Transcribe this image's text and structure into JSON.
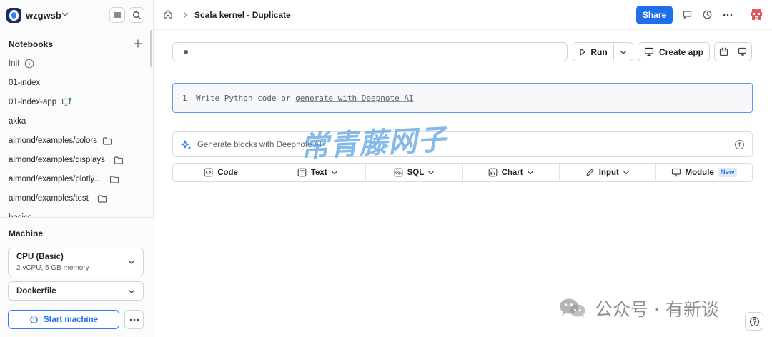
{
  "workspace": {
    "name": "wzgwsb"
  },
  "sidebar": {
    "notebooks_title": "Notebooks",
    "items": [
      {
        "label": "Init",
        "suffix_icon": "lightning-icon"
      },
      {
        "label": "01-index",
        "suffix_icon": ""
      },
      {
        "label": "01-index-app",
        "suffix_icon": "app-monitor-icon"
      },
      {
        "label": "akka",
        "suffix_icon": ""
      },
      {
        "label": "almond/examples/colors",
        "suffix_icon": "folder-icon"
      },
      {
        "label": "almond/examples/displays",
        "suffix_icon": "folder-icon"
      },
      {
        "label": "almond/examples/plotly...",
        "suffix_icon": "folder-icon"
      },
      {
        "label": "almond/examples/test",
        "suffix_icon": "folder-icon"
      },
      {
        "label": "basics",
        "suffix_icon": ""
      }
    ],
    "machine": {
      "title": "Machine",
      "cpu_name": "CPU (Basic)",
      "cpu_spec": "2 vCPU, 5 GB memory",
      "environment": "Dockerfile",
      "start_label": "Start machine"
    }
  },
  "topbar": {
    "breadcrumb_title": "Scala kernel - Duplicate",
    "share_label": "Share"
  },
  "notebook": {
    "run_label": "Run",
    "create_app_label": "Create app",
    "code_cell": {
      "line_number": "1",
      "placeholder_prefix": "Write Python code or ",
      "placeholder_link": "generate with Deepnote AI"
    },
    "generate_placeholder": "Generate blocks with Deepnote AI",
    "block_types": [
      {
        "label": "Code",
        "icon": "code-icon",
        "dropdown": false,
        "badge": ""
      },
      {
        "label": "Text",
        "icon": "text-icon",
        "dropdown": true,
        "badge": ""
      },
      {
        "label": "SQL",
        "icon": "sql-icon",
        "dropdown": true,
        "badge": ""
      },
      {
        "label": "Chart",
        "icon": "chart-icon",
        "dropdown": true,
        "badge": ""
      },
      {
        "label": "Input",
        "icon": "input-icon",
        "dropdown": true,
        "badge": ""
      },
      {
        "label": "Module",
        "icon": "module-icon",
        "dropdown": false,
        "badge": "New"
      }
    ]
  },
  "watermarks": {
    "overlay_text": "常青藤网子",
    "wechat_text": "公众号 · 有新谈"
  },
  "colors": {
    "accent": "#1f6feb",
    "cell_border": "#5b9bf0",
    "badge_bg": "#ddeafe"
  }
}
